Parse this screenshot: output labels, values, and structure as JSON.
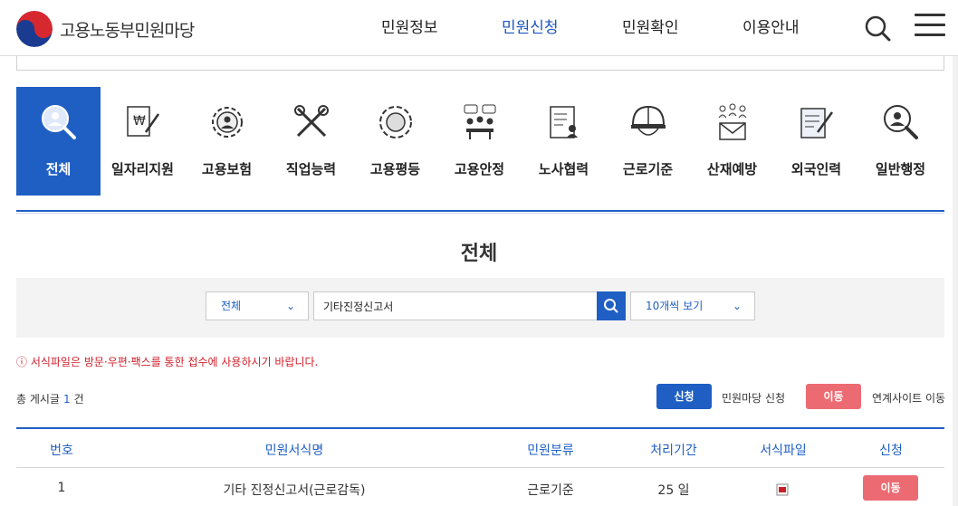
{
  "header": {
    "logo_text": "고용노동부민원마당",
    "nav": [
      {
        "label": "민원정보"
      },
      {
        "label": "민원신청"
      },
      {
        "label": "민원확인"
      },
      {
        "label": "이용안내"
      }
    ],
    "active_nav": "민원신청",
    "search_icon": "search-icon",
    "menu_icon": "hamburger-menu-icon"
  },
  "categories": [
    {
      "label": "전체",
      "icon": "magnifier-person-icon"
    },
    {
      "label": "일자리지원",
      "icon": "won-document-pen-icon"
    },
    {
      "label": "고용보험",
      "icon": "gear-person-icon"
    },
    {
      "label": "직업능력",
      "icon": "tools-icon"
    },
    {
      "label": "고용평등",
      "icon": "globe-people-icon"
    },
    {
      "label": "고용안정",
      "icon": "meeting-icon"
    },
    {
      "label": "노사협력",
      "icon": "document-person-icon"
    },
    {
      "label": "근로기준",
      "icon": "helmet-icon"
    },
    {
      "label": "산재예방",
      "icon": "people-mail-icon"
    },
    {
      "label": "외국인력",
      "icon": "document-pen-icon"
    },
    {
      "label": "일반행정",
      "icon": "magnifier-person-icon"
    }
  ],
  "active_category": "전체",
  "page_title": "전체",
  "search": {
    "scope_value": "전체",
    "keyword_value": "기타진정신고서",
    "page_size_value": "10개씩 보기",
    "search_icon": "search-icon"
  },
  "notice": "ⓘ 서식파일은 방문·우편·팩스를 통한 접수에 사용하시기 바랍니다.",
  "total": {
    "prefix": "총 게시글",
    "count": "1",
    "suffix": "건"
  },
  "legend": {
    "apply_button": "신청",
    "apply_desc": "민원마당 신청",
    "move_button": "이동",
    "move_desc": "연계사이트 이동"
  },
  "table": {
    "headers": [
      "번호",
      "민원서식명",
      "민원분류",
      "처리기간",
      "서식파일",
      "신청"
    ],
    "rows": [
      {
        "no": "1",
        "name": "기타 진정신고서(근로감독)",
        "category": "근로기준",
        "period": "25 일",
        "file_icon": "pdf-file-icon",
        "action": "이동"
      }
    ]
  },
  "colors": {
    "primary": "#1f5fc4",
    "danger": "#ec6b73",
    "notice": "#d0202b"
  }
}
